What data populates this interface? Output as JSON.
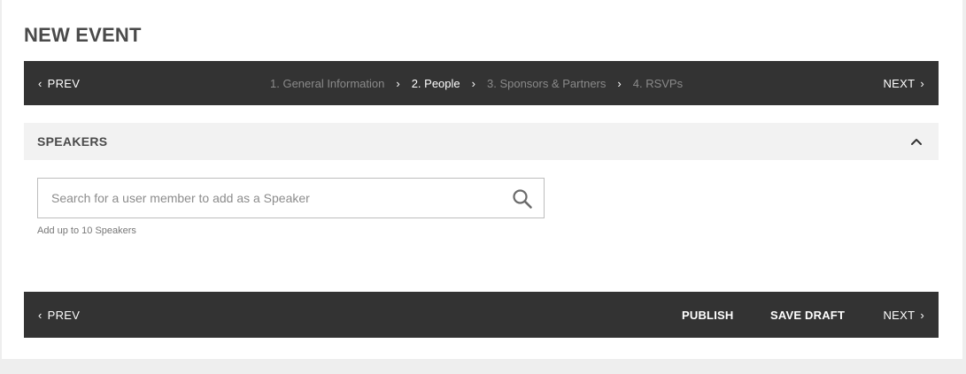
{
  "page": {
    "title": "NEW EVENT"
  },
  "wizard_top": {
    "prev_label": "PREV",
    "next_label": "NEXT",
    "steps": [
      {
        "label": "1. General Information",
        "state": "inactive"
      },
      {
        "label": "2. People",
        "state": "active"
      },
      {
        "label": "3. Sponsors & Partners",
        "state": "inactive"
      },
      {
        "label": "4. RSVPs",
        "state": "inactive"
      }
    ]
  },
  "speakers_section": {
    "title": "SPEAKERS",
    "expanded": true,
    "search": {
      "value": "",
      "placeholder": "Search for a user member to add as a Speaker"
    },
    "help_text": "Add up to 10 Speakers"
  },
  "wizard_bottom": {
    "prev_label": "PREV",
    "publish_label": "PUBLISH",
    "save_draft_label": "SAVE DRAFT",
    "next_label": "NEXT"
  },
  "colors": {
    "bar_background": "#333333",
    "inactive_step": "#8a8a8a",
    "active_step": "#ffffff",
    "section_header_background": "#f2f2f2",
    "page_background": "#eeeeee"
  },
  "icons": {
    "prev": "chevron-left-icon",
    "next": "chevron-right-icon",
    "step_separator": "chevron-right-icon",
    "collapse": "chevron-up-icon",
    "search": "search-icon"
  }
}
